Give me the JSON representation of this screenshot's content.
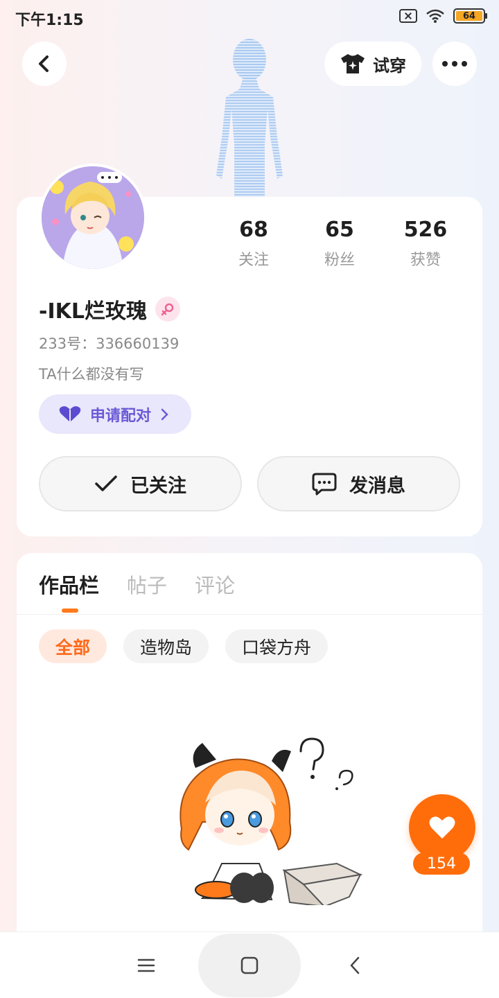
{
  "status_bar": {
    "time": "下午1:15",
    "battery_level": "64",
    "icons": [
      "sim-off-icon",
      "wifi-icon",
      "battery-icon"
    ]
  },
  "top_nav": {
    "back_icon": "chevron-left-icon",
    "try_on_label": "试穿",
    "try_on_icon": "tshirt-sparkle-icon",
    "more_icon": "more-horizontal-icon"
  },
  "profile": {
    "nickname": "-IKL烂玫瑰",
    "gender_icon": "female-icon",
    "uid": "233号：336660139",
    "bio": "TA什么都没有写",
    "pair_button_label": "申请配对",
    "stats": [
      {
        "value": "68",
        "label": "关注"
      },
      {
        "value": "65",
        "label": "粉丝"
      },
      {
        "value": "526",
        "label": "获赞"
      }
    ],
    "follow_button_label": "已关注",
    "message_button_label": "发消息"
  },
  "works": {
    "tabs": [
      "作品栏",
      "帖子",
      "评论"
    ],
    "active_tab": "作品栏",
    "filters": [
      "全部",
      "造物岛",
      "口袋方舟"
    ],
    "active_filter": "全部"
  },
  "floating_like": {
    "count": "154",
    "icon": "heart-icon"
  },
  "bottom_nav": {
    "items": [
      "menu-icon",
      "home-square-icon",
      "back-icon"
    ]
  },
  "colors": {
    "accent": "#ff6d0b",
    "pair_purple": "#6a5ad6",
    "chip_active_bg": "#ffe9df"
  }
}
